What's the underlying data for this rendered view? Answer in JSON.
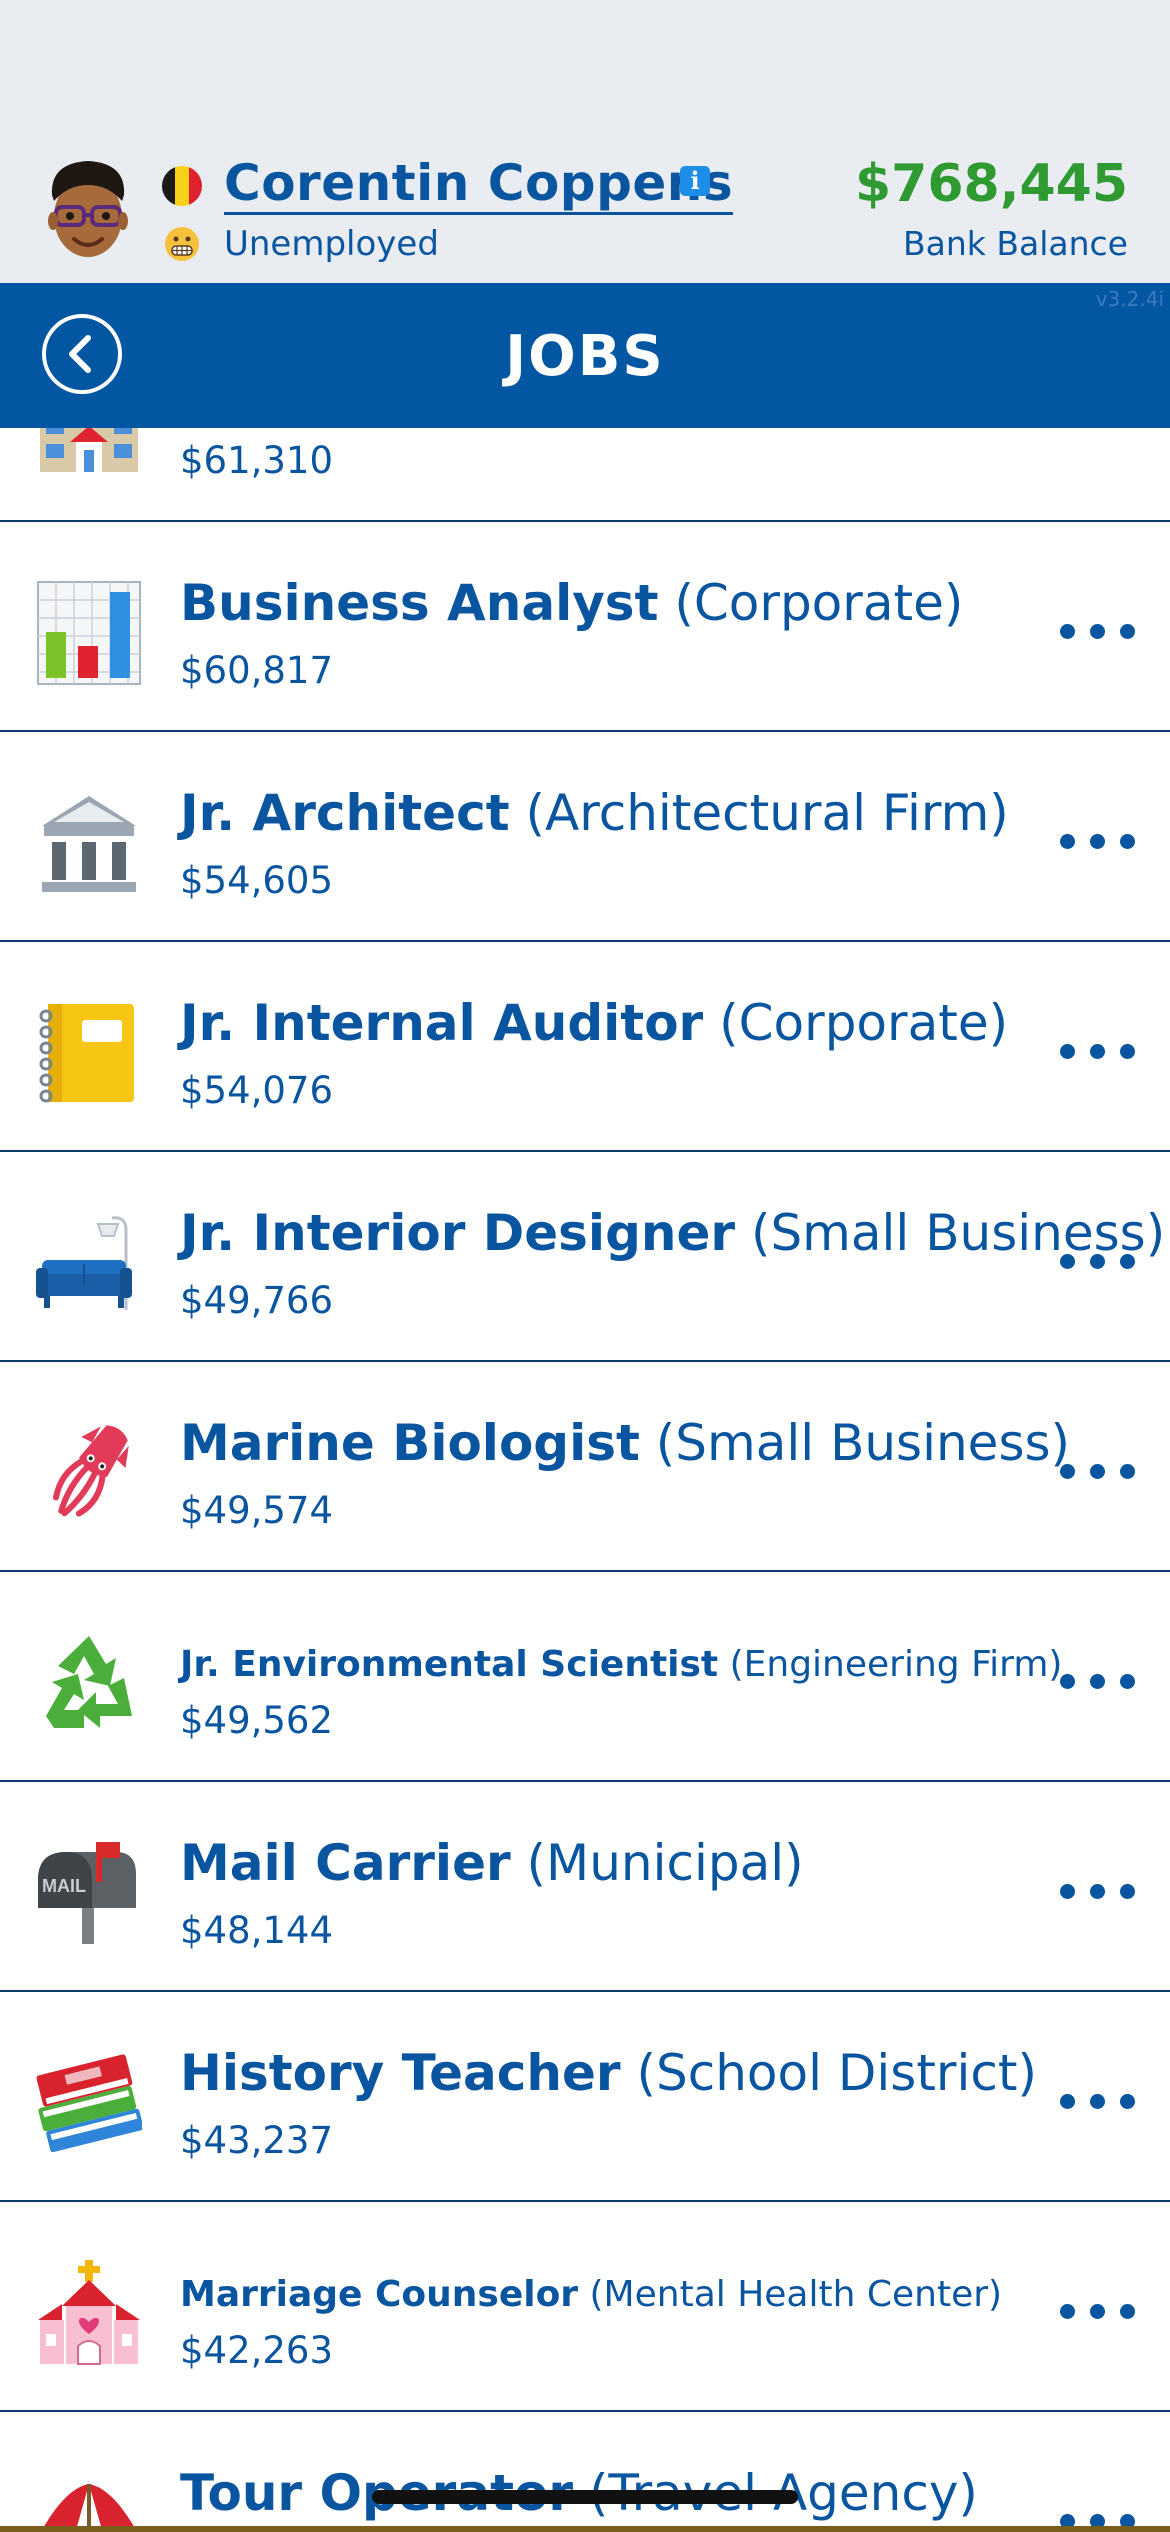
{
  "header": {
    "player_name": "Corentin Coppens",
    "info_badge": "i",
    "job_status": "Unemployed",
    "balance": "$768,445",
    "balance_label": "Bank Balance",
    "flag_colors": [
      "#1b1b1b",
      "#f7d117",
      "#e0212f"
    ]
  },
  "nav": {
    "title": "JOBS",
    "version": "v3.2.4i"
  },
  "jobs": [
    {
      "title": "",
      "employer": "",
      "salary": "$61,310",
      "icon": "office-building-icon"
    },
    {
      "title": "Business Analyst",
      "employer": "(Corporate)",
      "salary": "$60,817",
      "icon": "bar-chart-icon"
    },
    {
      "title": "Jr. Architect",
      "employer": "(Architectural Firm)",
      "salary": "$54,605",
      "icon": "classical-building-icon"
    },
    {
      "title": "Jr. Internal Auditor",
      "employer": "(Corporate)",
      "salary": "$54,076",
      "icon": "notebook-icon"
    },
    {
      "title": "Jr. Interior Designer",
      "employer": "(Small Business)",
      "salary": "$49,766",
      "icon": "couch-lamp-icon"
    },
    {
      "title": "Marine Biologist",
      "employer": "(Small Business)",
      "salary": "$49,574",
      "icon": "squid-icon"
    },
    {
      "title": "Jr. Environmental Scientist",
      "employer": "(Engineering Firm)",
      "salary": "$49,562",
      "icon": "recycle-icon"
    },
    {
      "title": "Mail Carrier",
      "employer": "(Municipal)",
      "salary": "$48,144",
      "icon": "mailbox-icon"
    },
    {
      "title": "History Teacher",
      "employer": "(School District)",
      "salary": "$43,237",
      "icon": "books-icon"
    },
    {
      "title": "Marriage Counselor",
      "employer": "(Mental Health Center)",
      "salary": "$42,263",
      "icon": "wedding-chapel-icon"
    },
    {
      "title": "Tour Operator",
      "employer": "(Travel Agency)",
      "salary": "",
      "icon": "beach-umbrella-icon"
    }
  ],
  "colors": {
    "brand_blue": "#0356a2",
    "text_blue": "#0a55a0",
    "balance_green": "#2f9a32",
    "header_bg": "#e9edf1"
  }
}
